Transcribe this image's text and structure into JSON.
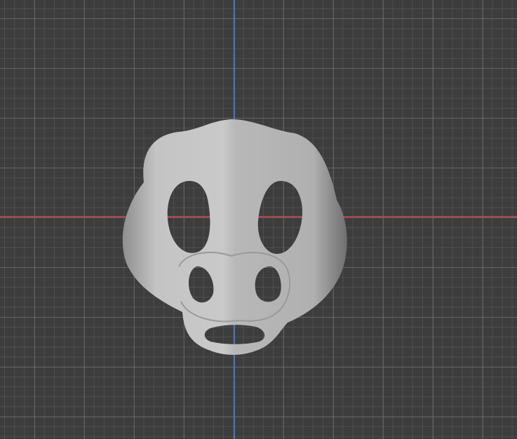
{
  "viewport": {
    "object": "mask-model",
    "colors": {
      "background": "#3d3d3d",
      "x_axis": "#b2434b",
      "y_axis": "#4f76b0",
      "model": "#b9b9b9"
    }
  }
}
